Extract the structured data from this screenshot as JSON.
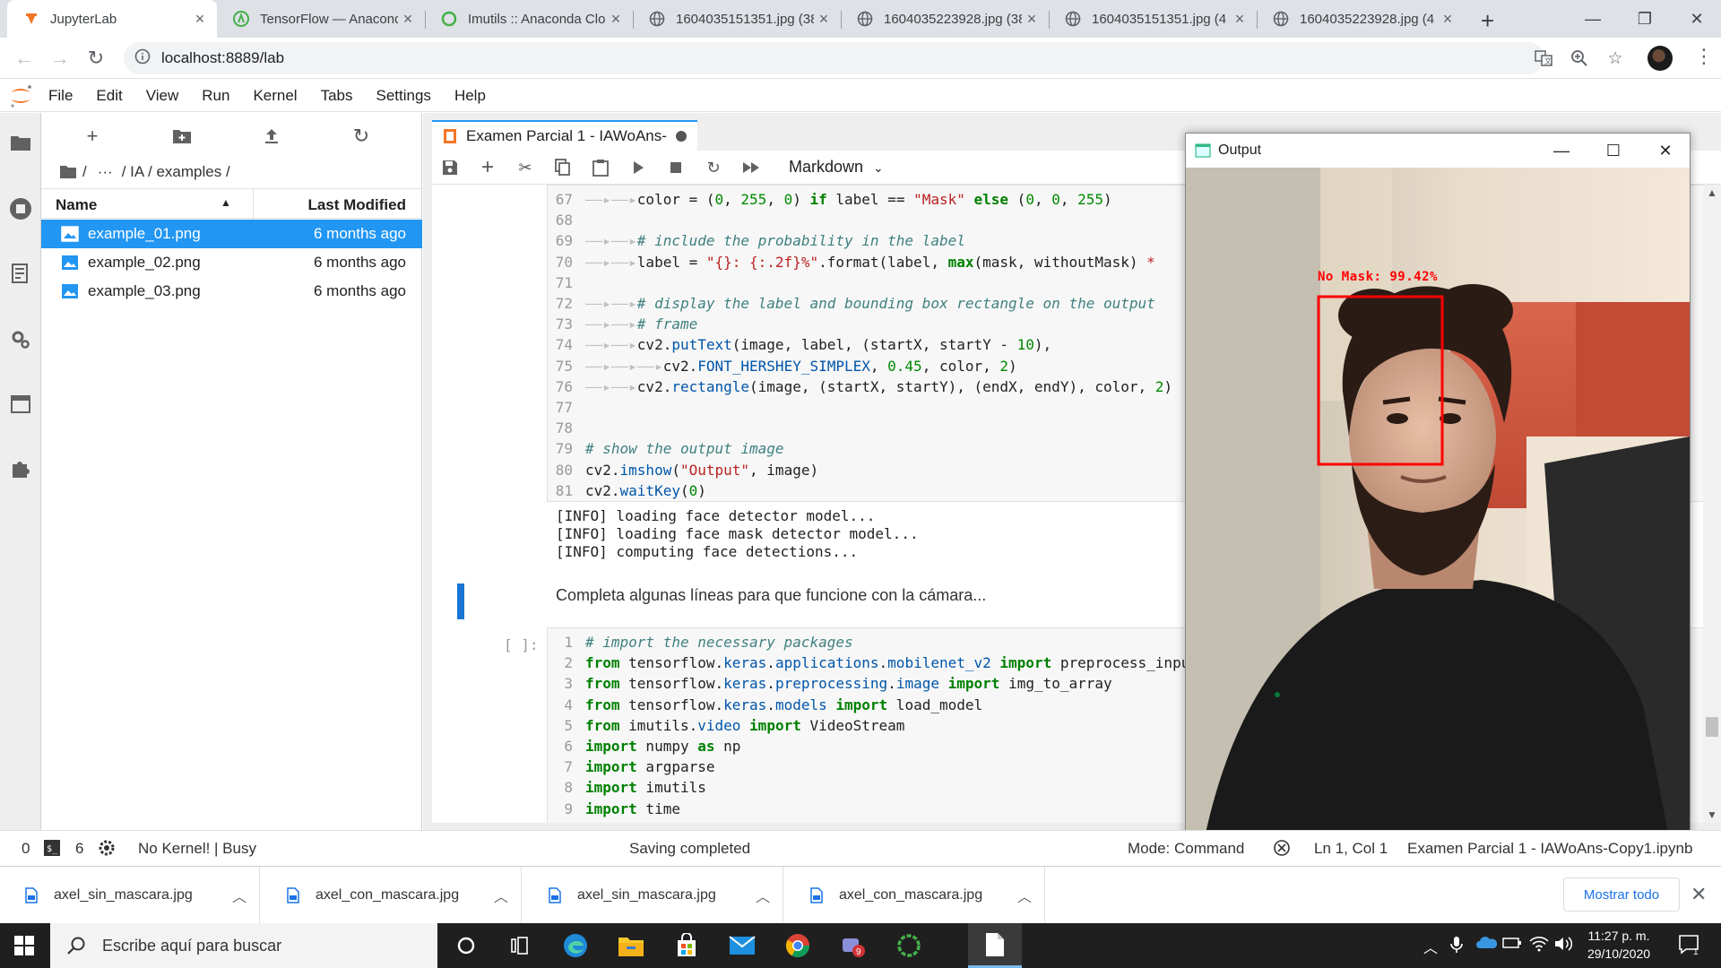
{
  "browser": {
    "tabs": [
      {
        "title": "JupyterLab",
        "icon": "jupyter-icon",
        "active": true
      },
      {
        "title": "TensorFlow — Anaconda",
        "icon": "anaconda-icon"
      },
      {
        "title": "Imutils :: Anaconda Clo",
        "icon": "loading-icon"
      },
      {
        "title": "1604035151351.jpg (38",
        "icon": "globe-icon"
      },
      {
        "title": "1604035223928.jpg (38",
        "icon": "globe-icon"
      },
      {
        "title": "1604035151351.jpg (4",
        "icon": "globe-icon"
      },
      {
        "title": "1604035223928.jpg (4",
        "icon": "globe-icon"
      }
    ],
    "url": "localhost:8889/lab"
  },
  "jupyter": {
    "menu": [
      "File",
      "Edit",
      "View",
      "Run",
      "Kernel",
      "Tabs",
      "Settings",
      "Help"
    ],
    "breadcrumb": {
      "root": "/",
      "ellipsis": "···",
      "path": "/ IA / examples /"
    },
    "file_header": {
      "name": "Name",
      "modified": "Last Modified"
    },
    "files": [
      {
        "name": "example_01.png",
        "modified": "6 months ago",
        "selected": true
      },
      {
        "name": "example_02.png",
        "modified": "6 months ago"
      },
      {
        "name": "example_03.png",
        "modified": "6 months ago"
      }
    ],
    "notebook_tab": "Examen Parcial 1 - IAWoAns-",
    "cell_type": "Markdown",
    "code_top": [
      {
        "n": "67",
        "html": "<span class='arr'>——▸——▸</span>color = (<span class='n'>0</span>, <span class='n'>255</span>, <span class='n'>0</span>) <span class='k'>if</span> label == <span class='s'>\"Mask\"</span> <span class='k'>else</span> (<span class='n'>0</span>, <span class='n'>0</span>, <span class='n'>255</span>)"
      },
      {
        "n": "68",
        "html": ""
      },
      {
        "n": "69",
        "html": "<span class='arr'>——▸——▸</span><span class='c'># include the probability in the label</span>"
      },
      {
        "n": "70",
        "html": "<span class='arr'>——▸——▸</span>label = <span class='s'>\"{}: {:.2f}%\"</span>.format(label, <span class='k'>max</span>(mask, withoutMask) <span class='s'>*</span>"
      },
      {
        "n": "71",
        "html": ""
      },
      {
        "n": "72",
        "html": "<span class='arr'>——▸——▸</span><span class='c'># display the label and bounding box rectangle on the output</span>"
      },
      {
        "n": "73",
        "html": "<span class='arr'>——▸——▸</span><span class='c'># frame</span>"
      },
      {
        "n": "74",
        "html": "<span class='arr'>——▸——▸</span>cv2.<span class='f'>putText</span>(image, label, (startX, startY - <span class='n'>10</span>),"
      },
      {
        "n": "75",
        "html": "<span class='arr'>——▸——▸——▸</span>cv2.<span class='f'>FONT_HERSHEY_SIMPLEX</span>, <span class='n'>0.45</span>, color, <span class='n'>2</span>)"
      },
      {
        "n": "76",
        "html": "<span class='arr'>——▸——▸</span>cv2.<span class='f'>rectangle</span>(image, (startX, startY), (endX, endY), color, <span class='n'>2</span>)"
      },
      {
        "n": "77",
        "html": ""
      },
      {
        "n": "78",
        "html": ""
      },
      {
        "n": "79",
        "html": "<span class='c'># show the output image</span>"
      },
      {
        "n": "80",
        "html": "cv2.<span class='f'>imshow</span>(<span class='s'>\"Output\"</span>, image)"
      },
      {
        "n": "81",
        "html": "cv2.<span class='f'>waitKey</span>(<span class='n'>0</span>)"
      }
    ],
    "output_text": "[INFO] loading face detector model...\n[INFO] loading face mask detector model...\n[INFO] computing face detections...",
    "markdown": "Completa algunas líneas para que funcione con la cámara...",
    "prompt": "[ ]:",
    "code_bottom": [
      {
        "n": "1",
        "html": "<span class='c'># import the necessary packages</span>"
      },
      {
        "n": "2",
        "html": "<span class='k'>from</span> tensorflow.<span class='f'>keras</span>.<span class='f'>applications</span>.<span class='f'>mobilenet_v2</span> <span class='k'>import</span> preprocess_input"
      },
      {
        "n": "3",
        "html": "<span class='k'>from</span> tensorflow.<span class='f'>keras</span>.<span class='f'>preprocessing</span>.<span class='f'>image</span> <span class='k'>import</span> img_to_array"
      },
      {
        "n": "4",
        "html": "<span class='k'>from</span> tensorflow.<span class='f'>keras</span>.<span class='f'>models</span> <span class='k'>import</span> load_model"
      },
      {
        "n": "5",
        "html": "<span class='k'>from</span> imutils.<span class='f'>video</span> <span class='k'>import</span> VideoStream"
      },
      {
        "n": "6",
        "html": "<span class='k'>import</span> numpy <span class='k'>as</span> np"
      },
      {
        "n": "7",
        "html": "<span class='k'>import</span> argparse"
      },
      {
        "n": "8",
        "html": "<span class='k'>import</span> imutils"
      },
      {
        "n": "9",
        "html": "<span class='k'>import</span> time"
      }
    ]
  },
  "output_window": {
    "title": "Output",
    "label": "No Mask: 99.42%"
  },
  "status": {
    "left_count": "0",
    "terminals": "6",
    "kernel": "No Kernel! | Busy",
    "saving": "Saving completed",
    "mode": "Mode: Command",
    "position": "Ln 1, Col 1",
    "filename": "Examen Parcial 1 - IAWoAns-Copy1.ipynb"
  },
  "downloads": {
    "items": [
      "axel_sin_mascara.jpg",
      "axel_con_mascara.jpg",
      "axel_sin_mascara.jpg",
      "axel_con_mascara.jpg"
    ],
    "show_all": "Mostrar todo"
  },
  "taskbar": {
    "search_placeholder": "Escribe aquí para buscar",
    "time": "11:27 p. m.",
    "date": "29/10/2020",
    "badge": "9",
    "notif": "1"
  },
  "colors": {
    "jupyter_blue": "#2196f3",
    "jupyter_orange": "#f37726",
    "detect_red": "#ff0000"
  }
}
